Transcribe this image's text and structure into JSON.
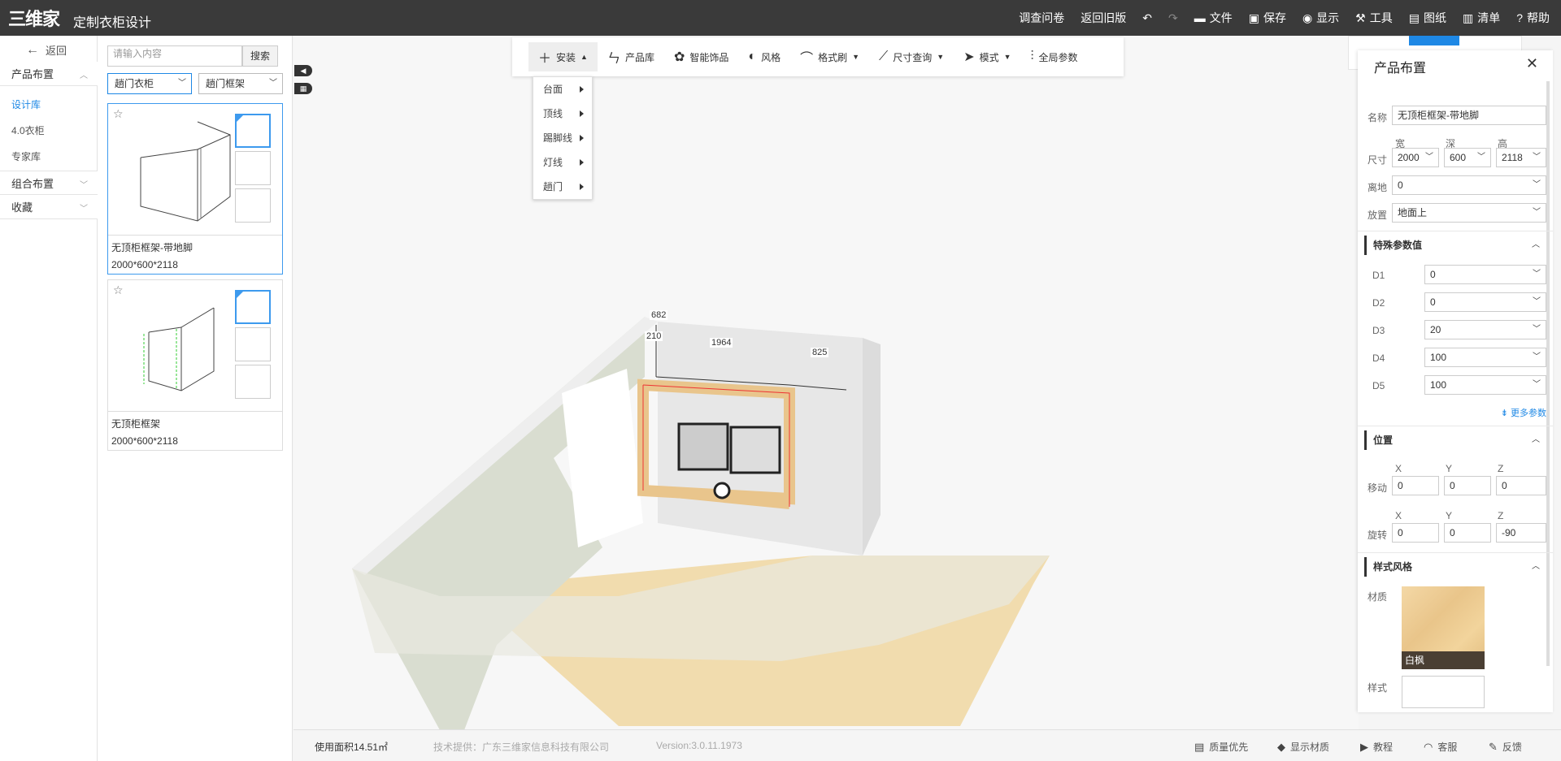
{
  "header": {
    "logo_text": "三维家",
    "app_title": "定制衣柜设计",
    "nav": [
      {
        "label": "调查问卷",
        "icon": ""
      },
      {
        "label": "返回旧版",
        "icon": ""
      },
      {
        "label": "文件",
        "icon": "folder-icon"
      },
      {
        "label": "保存",
        "icon": "save-icon"
      },
      {
        "label": "显示",
        "icon": "eye-icon"
      },
      {
        "label": "工具",
        "icon": "wrench-icon"
      },
      {
        "label": "图纸",
        "icon": "map-icon"
      },
      {
        "label": "清单",
        "icon": "list-icon"
      },
      {
        "label": "帮助",
        "icon": "help-icon"
      }
    ]
  },
  "leftnav": {
    "back_label": "返回",
    "sections": [
      {
        "label": "产品布置",
        "expanded": true
      },
      {
        "label": "组合布置",
        "expanded": false
      },
      {
        "label": "收藏",
        "expanded": false
      }
    ],
    "subitems": [
      "设计库",
      "4.0衣柜",
      "专家库"
    ],
    "active_sub": "设计库"
  },
  "library": {
    "search_placeholder": "请输入内容",
    "search_button": "搜索",
    "filter1": "趟门衣柜",
    "filter2": "趟门框架",
    "cards": [
      {
        "name": "无顶柜框架-带地脚",
        "size": "2000*600*2118",
        "selected": true
      },
      {
        "name": "无顶柜框架",
        "size": "2000*600*2118",
        "selected": false
      }
    ]
  },
  "toolbar": {
    "items": [
      {
        "label": "安装",
        "icon": "plus-icon",
        "caret": "up",
        "active": true
      },
      {
        "label": "产品库",
        "icon": "chair-icon"
      },
      {
        "label": "智能饰品",
        "icon": "plant-icon"
      },
      {
        "label": "风格",
        "icon": "palette-icon"
      },
      {
        "label": "格式刷",
        "icon": "brush-icon",
        "caret": "down"
      },
      {
        "label": "尺寸查询",
        "icon": "ruler-icon",
        "caret": "down"
      },
      {
        "label": "模式",
        "icon": "cursor-icon",
        "caret": "down"
      },
      {
        "label": "全局参数",
        "icon": "sliders-icon"
      }
    ],
    "dropdown": [
      "台面",
      "顶线",
      "踢脚线",
      "灯线",
      "趟门"
    ]
  },
  "scene": {
    "dims": [
      "682",
      "210",
      "1964",
      "825"
    ],
    "floor_color": "#f1dcae",
    "wall_color": "#d9ddd0",
    "frame_color": "#e9c58c"
  },
  "panel": {
    "title": "产品布置",
    "name_label": "名称",
    "name_value": "无顶柜框架-带地脚",
    "size_label": "尺寸",
    "size_heads": [
      "宽",
      "深",
      "高"
    ],
    "size_values": [
      "2000",
      "600",
      "2118"
    ],
    "ground_label": "离地",
    "ground_value": "0",
    "place_label": "放置",
    "place_value": "地面上",
    "special_title": "特殊参数值",
    "params": [
      {
        "key": "D1",
        "value": "0"
      },
      {
        "key": "D2",
        "value": "0"
      },
      {
        "key": "D3",
        "value": "20"
      },
      {
        "key": "D4",
        "value": "100"
      },
      {
        "key": "D5",
        "value": "100"
      }
    ],
    "more_label": "更多参数",
    "position_title": "位置",
    "xyz": [
      "X",
      "Y",
      "Z"
    ],
    "move_label": "移动",
    "move_values": [
      "0",
      "0",
      "0"
    ],
    "rotate_label": "旋转",
    "rotate_values": [
      "0",
      "0",
      "-90"
    ],
    "style_title": "样式风格",
    "material_label": "材质",
    "material_name": "白枫",
    "style_label": "样式"
  },
  "status": {
    "area": "使用面积14.51㎡",
    "provider": "技术提供：广东三维家信息科技有限公司",
    "version": "Version:3.0.11.1973",
    "right": [
      {
        "label": "质量优先",
        "icon": "quality-icon"
      },
      {
        "label": "显示材质",
        "icon": "cube-icon"
      },
      {
        "label": "教程",
        "icon": "video-icon"
      },
      {
        "label": "客服",
        "icon": "headset-icon"
      },
      {
        "label": "反馈",
        "icon": "edit-icon"
      }
    ]
  }
}
